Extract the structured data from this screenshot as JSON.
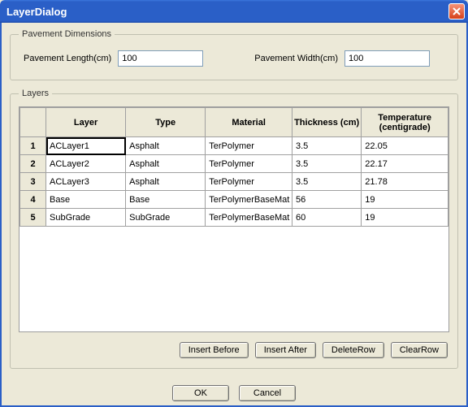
{
  "window": {
    "title": "LayerDialog"
  },
  "dimensions": {
    "legend": "Pavement Dimensions",
    "length_label": "Pavement Length(cm)",
    "length_value": "100",
    "width_label": "Pavement Width(cm)",
    "width_value": "100"
  },
  "layers": {
    "legend": "Layers",
    "columns": {
      "layer": "Layer",
      "type": "Type",
      "material": "Material",
      "thickness": "Thickness (cm)",
      "temperature": "Temperature (centigrade)"
    },
    "rows": [
      {
        "n": "1",
        "layer": "ACLayer1",
        "type": "Asphalt",
        "material": "TerPolymer",
        "thickness": "3.5",
        "temp": "22.05",
        "selected": true
      },
      {
        "n": "2",
        "layer": "ACLayer2",
        "type": "Asphalt",
        "material": "TerPolymer",
        "thickness": "3.5",
        "temp": "22.17"
      },
      {
        "n": "3",
        "layer": "ACLayer3",
        "type": "Asphalt",
        "material": "TerPolymer",
        "thickness": "3.5",
        "temp": "21.78"
      },
      {
        "n": "4",
        "layer": "Base",
        "type": "Base",
        "material": "TerPolymerBaseMat",
        "thickness": "56",
        "temp": "19"
      },
      {
        "n": "5",
        "layer": "SubGrade",
        "type": "SubGrade",
        "material": "TerPolymerBaseMat",
        "thickness": "60",
        "temp": "19"
      }
    ]
  },
  "buttons": {
    "insert_before": "Insert Before",
    "insert_after": "Insert After",
    "delete_row": "DeleteRow",
    "clear_row": "ClearRow",
    "ok": "OK",
    "cancel": "Cancel"
  }
}
